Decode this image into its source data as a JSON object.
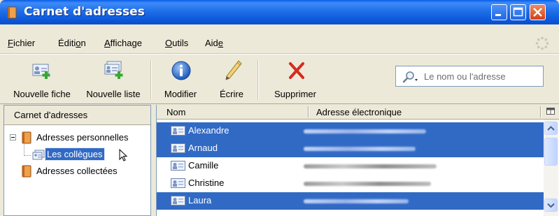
{
  "window": {
    "title": "Carnet d'adresses"
  },
  "menubar": {
    "items": [
      "Fichier",
      "Édition",
      "Affichage",
      "Outils",
      "Aide"
    ]
  },
  "toolbar": {
    "new_card": "Nouvelle fiche",
    "new_list": "Nouvelle liste",
    "edit": "Modifier",
    "write": "Écrire",
    "delete": "Supprimer",
    "search_placeholder": "Le nom ou l'adresse"
  },
  "sidebar": {
    "header": "Carnet d'adresses",
    "items": [
      {
        "label": "Adresses personnelles",
        "expanded": true
      },
      {
        "label": "Les collègues",
        "selected": true
      },
      {
        "label": "Adresses collectées"
      }
    ]
  },
  "contacts": {
    "columns": [
      "Nom",
      "Adresse électronique"
    ],
    "rows": [
      {
        "name": "Alexandre",
        "selected": true
      },
      {
        "name": "Arnaud",
        "selected": true
      },
      {
        "name": "Camille",
        "selected": false
      },
      {
        "name": "Christine",
        "selected": false
      },
      {
        "name": "Laura",
        "selected": true
      }
    ]
  },
  "colors": {
    "titlebar": "#0a5ee9",
    "selection": "#316ac5",
    "chrome": "#ece9d8"
  }
}
